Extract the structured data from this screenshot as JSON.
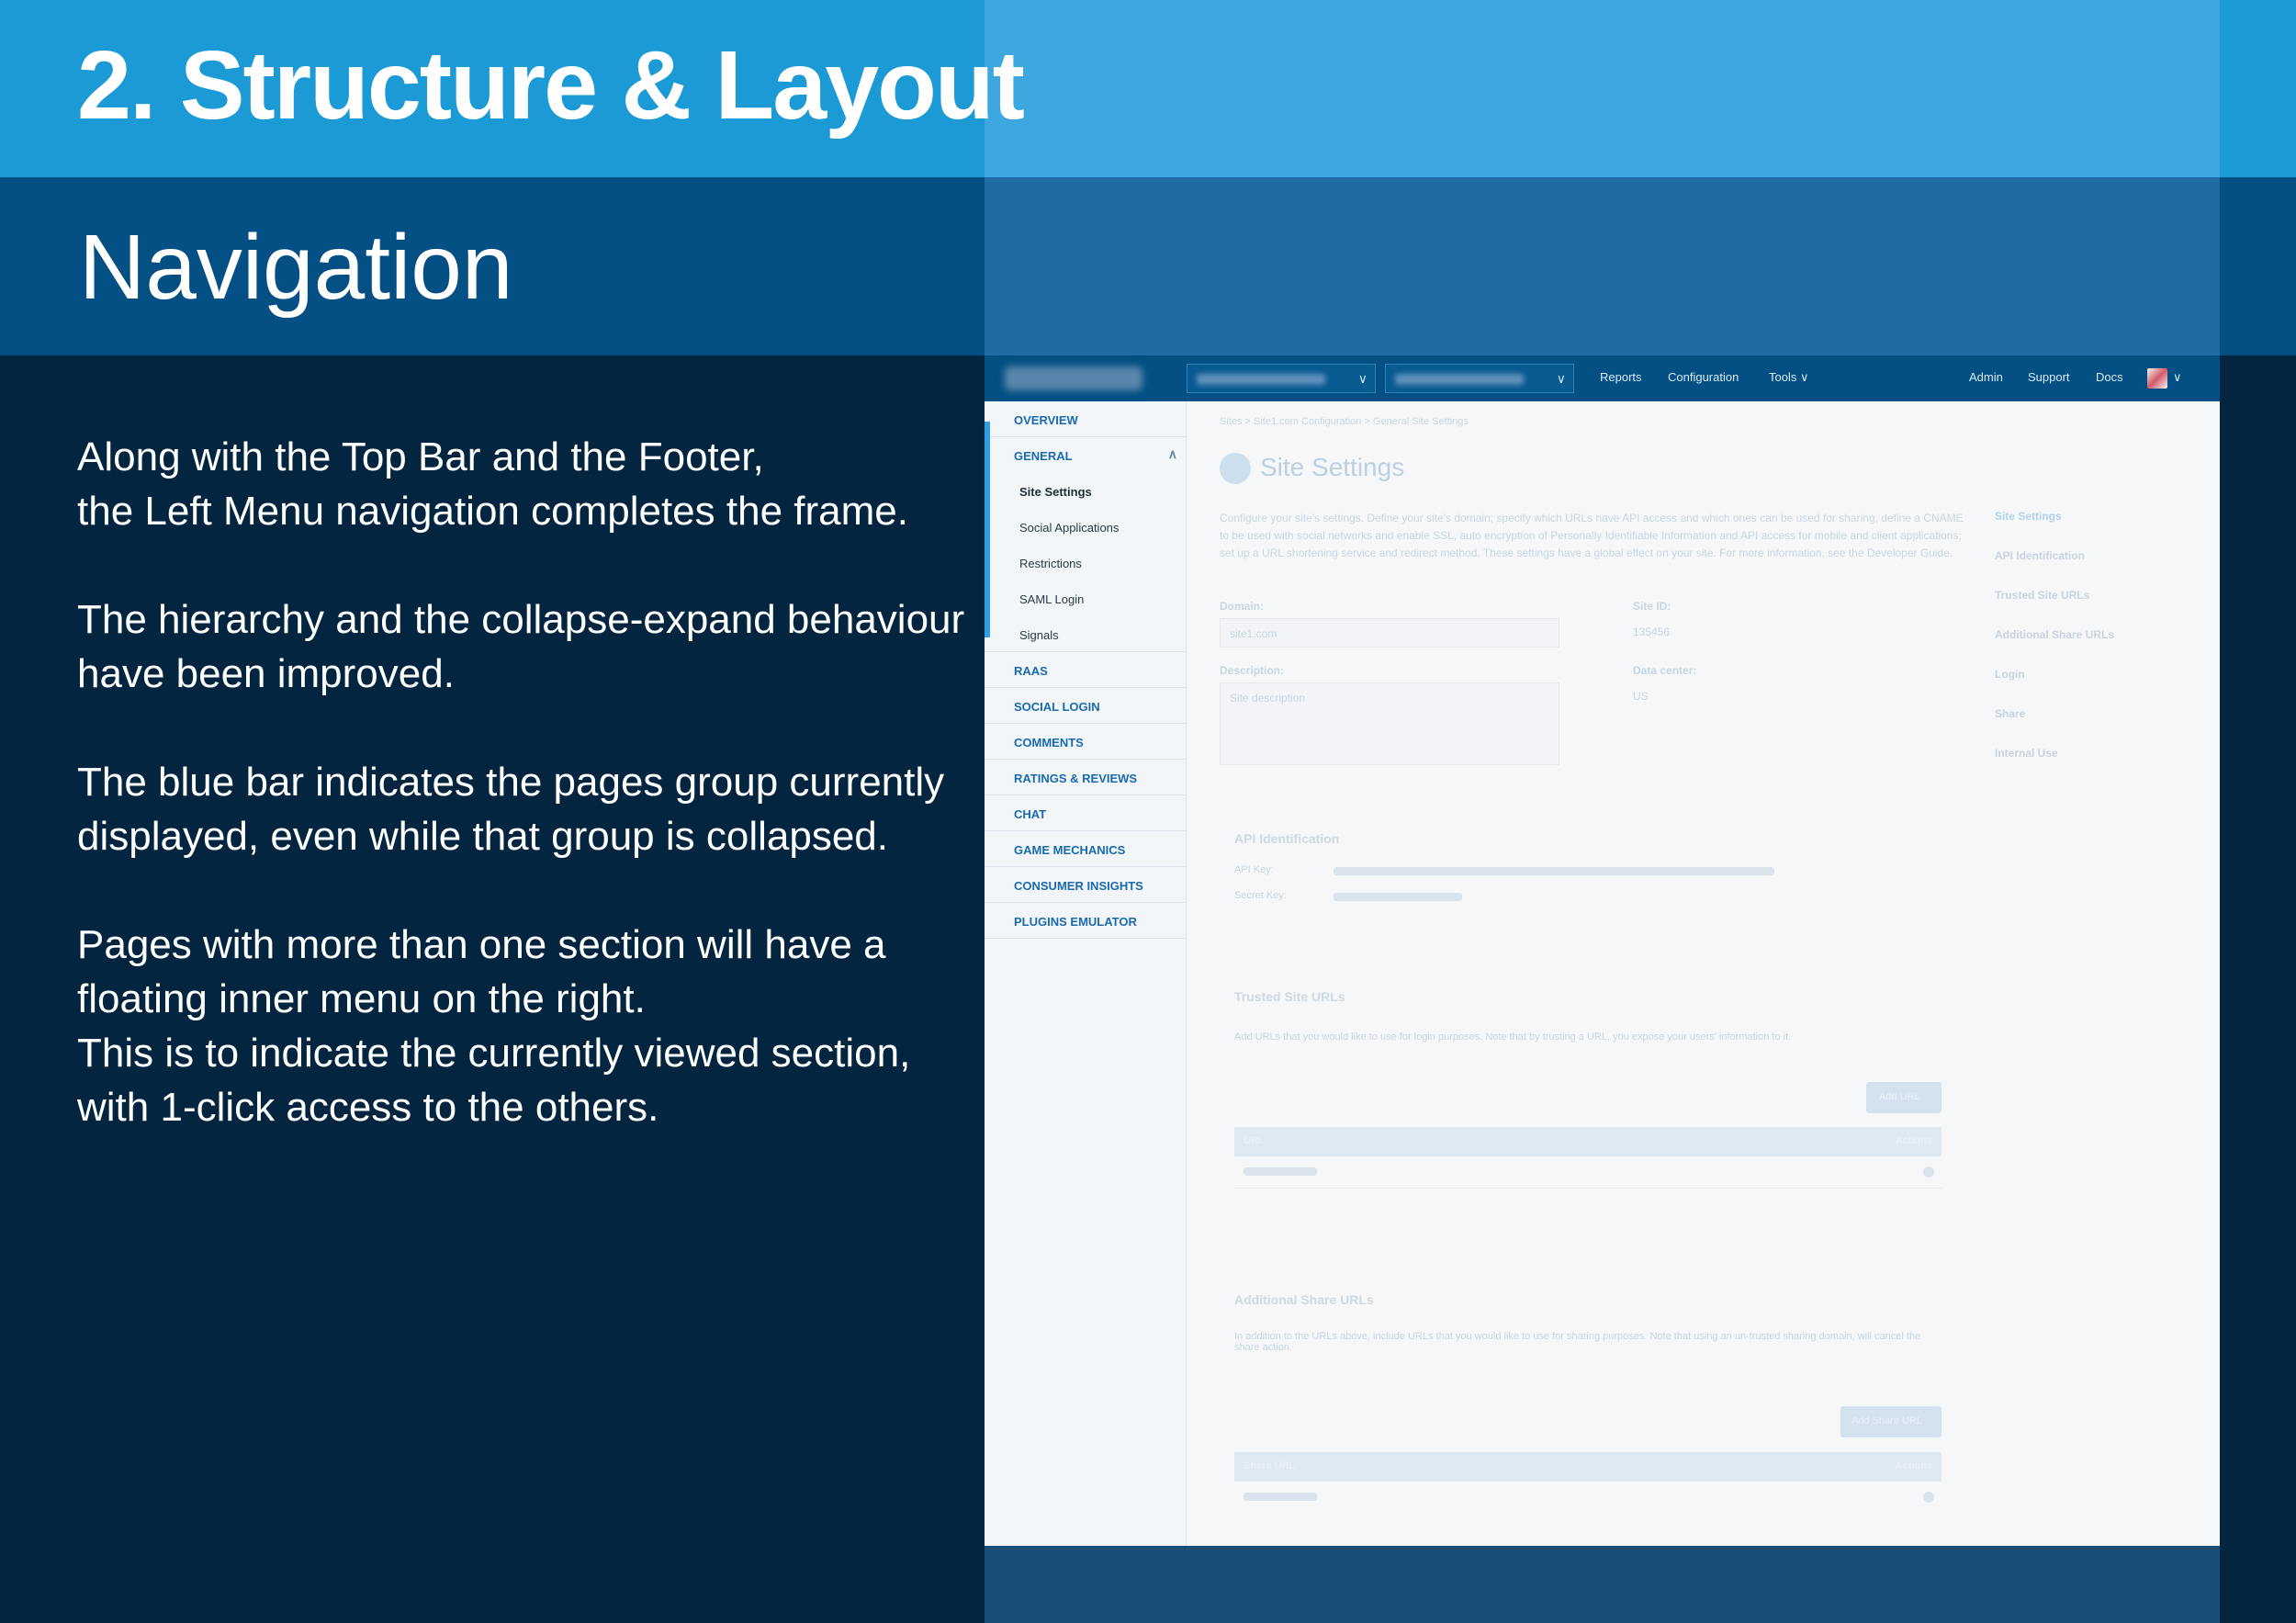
{
  "slide": {
    "title": "2. Structure & Layout",
    "subtitle": "Navigation",
    "paragraphs": [
      [
        "Along with the Top Bar and the Footer,",
        "the Left Menu navigation completes the frame."
      ],
      [
        "The hierarchy and the collapse-expand behaviour",
        "have been improved."
      ],
      [
        "The blue bar indicates the pages group currently",
        "displayed, even while that group is collapsed."
      ],
      [
        "Pages with more than one section will have a",
        "floating inner menu on the right.",
        "This is to indicate the currently viewed section,",
        "with 1-click access to the others."
      ]
    ]
  },
  "app": {
    "topnav": {
      "reports": "Reports",
      "configuration": "Configuration",
      "tools": "Tools",
      "admin": "Admin",
      "support": "Support",
      "docs": "Docs"
    },
    "sidebar": {
      "overview": "OVERVIEW",
      "general": "GENERAL",
      "general_items": [
        "Site Settings",
        "Social Applications",
        "Restrictions",
        "SAML Login",
        "Signals"
      ],
      "groups": [
        "RAAS",
        "SOCIAL LOGIN",
        "COMMENTS",
        "RATINGS & REVIEWS",
        "CHAT",
        "GAME MECHANICS",
        "CONSUMER INSIGHTS",
        "PLUGINS EMULATOR"
      ]
    },
    "page": {
      "heading": "Site Settings",
      "breadcrumb": "Sites > Site1.com Configuration > General Site Settings",
      "intro": "Configure your site's settings. Define your site's domain; specify which URLs have API access and which ones can be used for sharing, define a CNAME to be used with social networks and enable SSL, auto encryption of Personally Identifiable Information and API access for mobile and client applications; set up a URL shortening service and redirect method. These settings have a global effect on your site. For more information, see the Developer Guide.",
      "domain_label": "Domain:",
      "domain_value": "site1.com",
      "site_id_label": "Site ID:",
      "site_id_value": "135456",
      "description_label": "Description:",
      "description_placeholder": "Site description",
      "data_center_label": "Data center:",
      "data_center_value": "US",
      "api_section": "API Identification",
      "api_key_label": "API Key:",
      "secret_key_label": "Secret Key:",
      "trusted_section": "Trusted Site URLs",
      "trusted_desc": "Add URLs that you would like to use for login purposes. Note that by trusting a URL, you expose your users' information to it.",
      "add_url": "Add URL",
      "url_col": "URL",
      "actions_col": "Actions",
      "share_section": "Additional Share URLs",
      "share_desc": "In addition to the URLs above, include URLs that you would like to use for sharing purposes. Note that using an un-trusted sharing domain, will cancel the share action.",
      "add_share_url": "Add Share URL",
      "share_url_col": "Share URL"
    },
    "inner_menu": [
      "Site Settings",
      "API Identification",
      "Trusted Site URLs",
      "Additional Share URLs",
      "Login",
      "Share",
      "Internal Use"
    ]
  }
}
